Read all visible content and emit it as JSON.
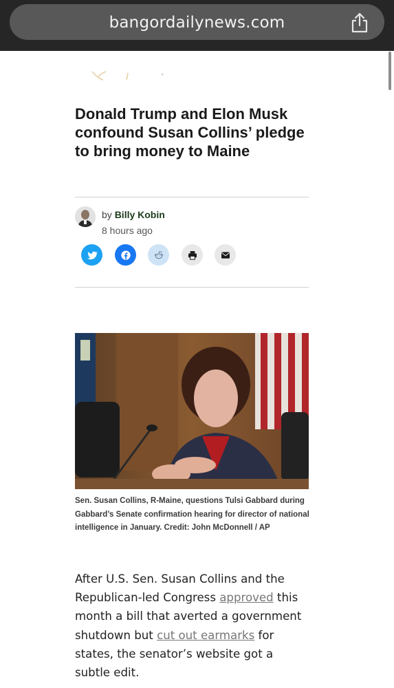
{
  "browser": {
    "url": "bangordailynews.com"
  },
  "article": {
    "title": "Donald Trump and Elon Musk confound Susan Collins’ pledge to bring money to Maine",
    "byline_prefix": "by",
    "author": "Billy Kobin",
    "timestamp": "8 hours ago",
    "share_buttons": [
      {
        "name": "twitter",
        "color": "#1da1f2"
      },
      {
        "name": "facebook",
        "color": "#1877f2"
      },
      {
        "name": "reddit",
        "color": "#cfe3f7"
      },
      {
        "name": "print",
        "color": "#e8e8e8"
      },
      {
        "name": "email",
        "color": "#e8e8e8"
      }
    ],
    "caption": "Sen. Susan Collins, R-Maine, questions Tulsi Gabbard during Gabbard’s Senate confirmation hearing for director of national intelligence in January. Credit: John McDonnell / AP",
    "body": {
      "part1": "After U.S. Sen. Susan Collins and the Republican-led Congress ",
      "link1": "approved",
      "part2": " this month a bill that averted a government shutdown but ",
      "link2": "cut out earmarks",
      "part3": " for states, the senator’s website got a subtle edit."
    }
  }
}
